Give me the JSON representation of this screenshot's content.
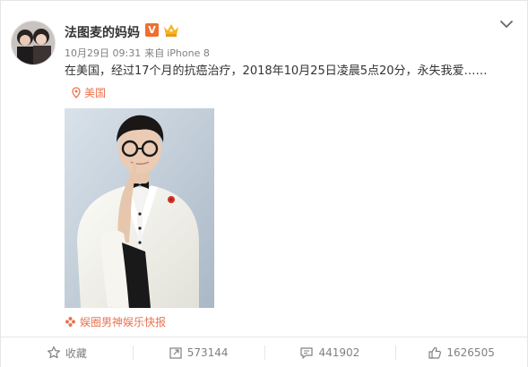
{
  "user": {
    "name": "法图麦的妈妈",
    "verified_badge": "V",
    "member_badge_icon": "crown-member-icon"
  },
  "post": {
    "date": "10月29日 09:31",
    "source_prefix": "来自",
    "device": "iPhone 8",
    "text": "在美国，经过17个月的抗癌治疗，2018年10月25日凌晨5点20分，永失我爱……",
    "location": "美国",
    "source_account": "娱圈男神娱乐快报"
  },
  "actions": {
    "favorite_label": "收藏",
    "repost_count": "573144",
    "comment_count": "441902",
    "like_count": "1626505"
  },
  "colors": {
    "accent_orange": "#eb7350",
    "text_gray": "#808080",
    "border": "#e6e6e6"
  }
}
